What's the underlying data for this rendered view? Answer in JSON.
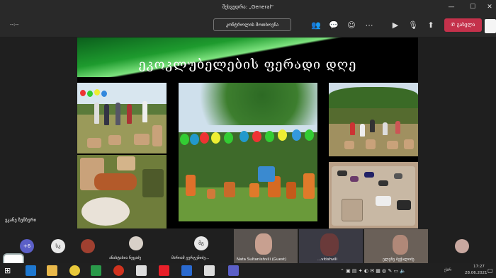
{
  "window": {
    "title": "შეხვედრა: „General“",
    "minimize_icon": "minimize-icon",
    "maximize_icon": "maximize-icon",
    "close_icon": "close-icon"
  },
  "toolbar": {
    "timer": "--:--",
    "control_label": "კონტროლის მოთხოვნა",
    "icons": [
      "people-icon",
      "chat-icon",
      "reactions-icon",
      "more-icon",
      "camera-off-icon",
      "mic-off-icon",
      "share-icon"
    ],
    "leave_label": "გასვლა",
    "leave_color": "#c4314b"
  },
  "slide": {
    "title": "ეკოკლუბელების ფერადი დღე",
    "accent_color": "#1e9b2e"
  },
  "presenter": {
    "name": "ეკანე ზუმბური"
  },
  "participants": {
    "overflow_count": "+6",
    "tiles": [
      {
        "initials": "სკ",
        "name": ""
      },
      {
        "initials": "",
        "name": ""
      },
      {
        "initials": "",
        "name": "ანასტასია ნუცაძე"
      },
      {
        "initials": "მგ",
        "name": "მარიამ გურგენიძე..."
      },
      {
        "initials": "",
        "name": "Nata Sultanishvili (Guest)"
      },
      {
        "initials": "",
        "name": "...vitishvili"
      },
      {
        "initials": "",
        "name": "ელენე ბეჭალიძე"
      },
      {
        "initials": "",
        "name": ""
      }
    ]
  },
  "taskbar": {
    "time": "17:27",
    "date": "28.06.2021",
    "lang": "ქარ"
  }
}
